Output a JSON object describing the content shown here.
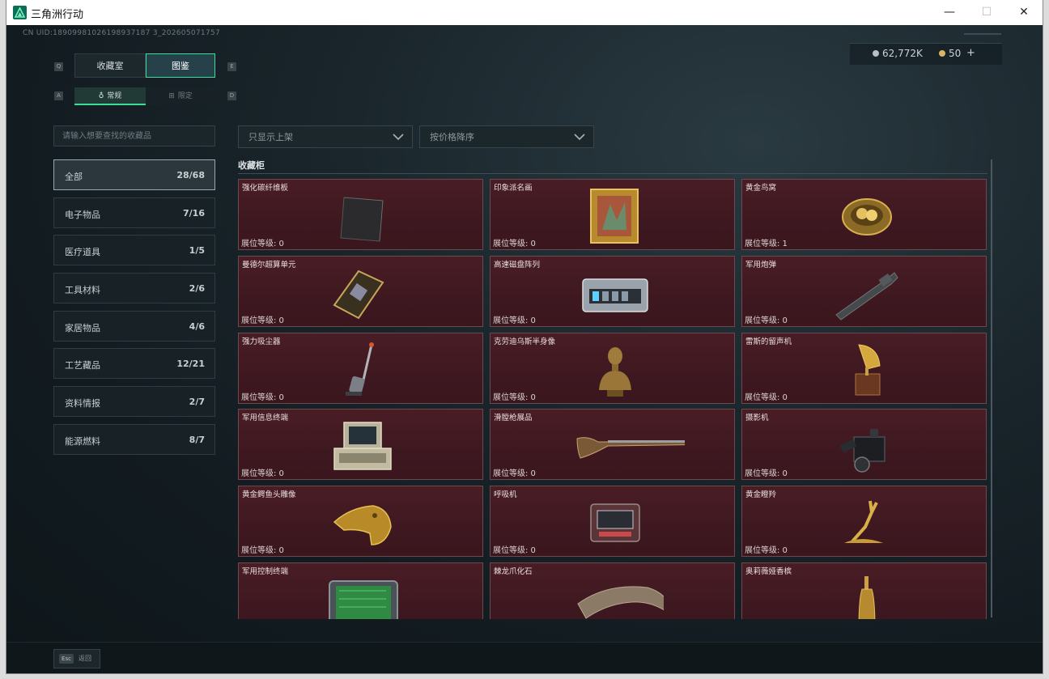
{
  "window": {
    "title": "三角洲行动"
  },
  "header": {
    "uid": "CN UID:18909981026198937187 3_202605071757",
    "currency_money": "62,772K",
    "currency_coin": "50",
    "currency_add": "+"
  },
  "tabs": {
    "key_left": "Q",
    "key_right": "E",
    "items": [
      {
        "label": "收藏室"
      },
      {
        "label": "图鉴"
      }
    ]
  },
  "subtabs": {
    "key_left": "A",
    "key_right": "D",
    "items": [
      {
        "label": "常规"
      },
      {
        "label": "限定"
      }
    ]
  },
  "search": {
    "placeholder": "请输入想要查找的收藏品"
  },
  "filters": {
    "shelf": "只显示上架",
    "sort": "按价格降序"
  },
  "categories": [
    {
      "label": "全部",
      "count": "28/68"
    },
    {
      "label": "电子物品",
      "count": "7/16"
    },
    {
      "label": "医疗道具",
      "count": "1/5"
    },
    {
      "label": "工具材料",
      "count": "2/6"
    },
    {
      "label": "家居物品",
      "count": "4/6"
    },
    {
      "label": "工艺藏品",
      "count": "12/21"
    },
    {
      "label": "资料情报",
      "count": "2/7"
    },
    {
      "label": "能源燃料",
      "count": "8/7"
    }
  ],
  "section": {
    "title": "收藏柜"
  },
  "items": [
    {
      "name": "强化碳纤维板",
      "level": "展位等级: 0"
    },
    {
      "name": "印象派名画",
      "level": "展位等级: 0"
    },
    {
      "name": "黄金鸟窝",
      "level": "展位等级: 1"
    },
    {
      "name": "曼德尔超算单元",
      "level": "展位等级: 0"
    },
    {
      "name": "高速磁盘阵列",
      "level": "展位等级: 0"
    },
    {
      "name": "军用炮弹",
      "level": "展位等级: 0"
    },
    {
      "name": "强力吸尘器",
      "level": "展位等级: 0"
    },
    {
      "name": "克劳迪乌斯半身像",
      "level": "展位等级: 0"
    },
    {
      "name": "雷斯的留声机",
      "level": "展位等级: 0"
    },
    {
      "name": "军用信息终端",
      "level": "展位等级: 0"
    },
    {
      "name": "滑膛枪展品",
      "level": "展位等级: 0"
    },
    {
      "name": "摄影机",
      "level": "展位等级: 0"
    },
    {
      "name": "黄金鳄鱼头雕像",
      "level": "展位等级: 0"
    },
    {
      "name": "呼吸机",
      "level": "展位等级: 0"
    },
    {
      "name": "黄金瞪羚",
      "level": "展位等级: 0"
    },
    {
      "name": "军用控制终端",
      "level": ""
    },
    {
      "name": "棘龙爪化石",
      "level": ""
    },
    {
      "name": "奥莉薇娅香槟",
      "level": ""
    }
  ],
  "footer": {
    "esc_key": "Esc",
    "esc_label": "返回"
  },
  "colors": {
    "accent": "#3ddc97",
    "card_bg": "#4a1d25",
    "card_border": "#6a4a4f"
  }
}
